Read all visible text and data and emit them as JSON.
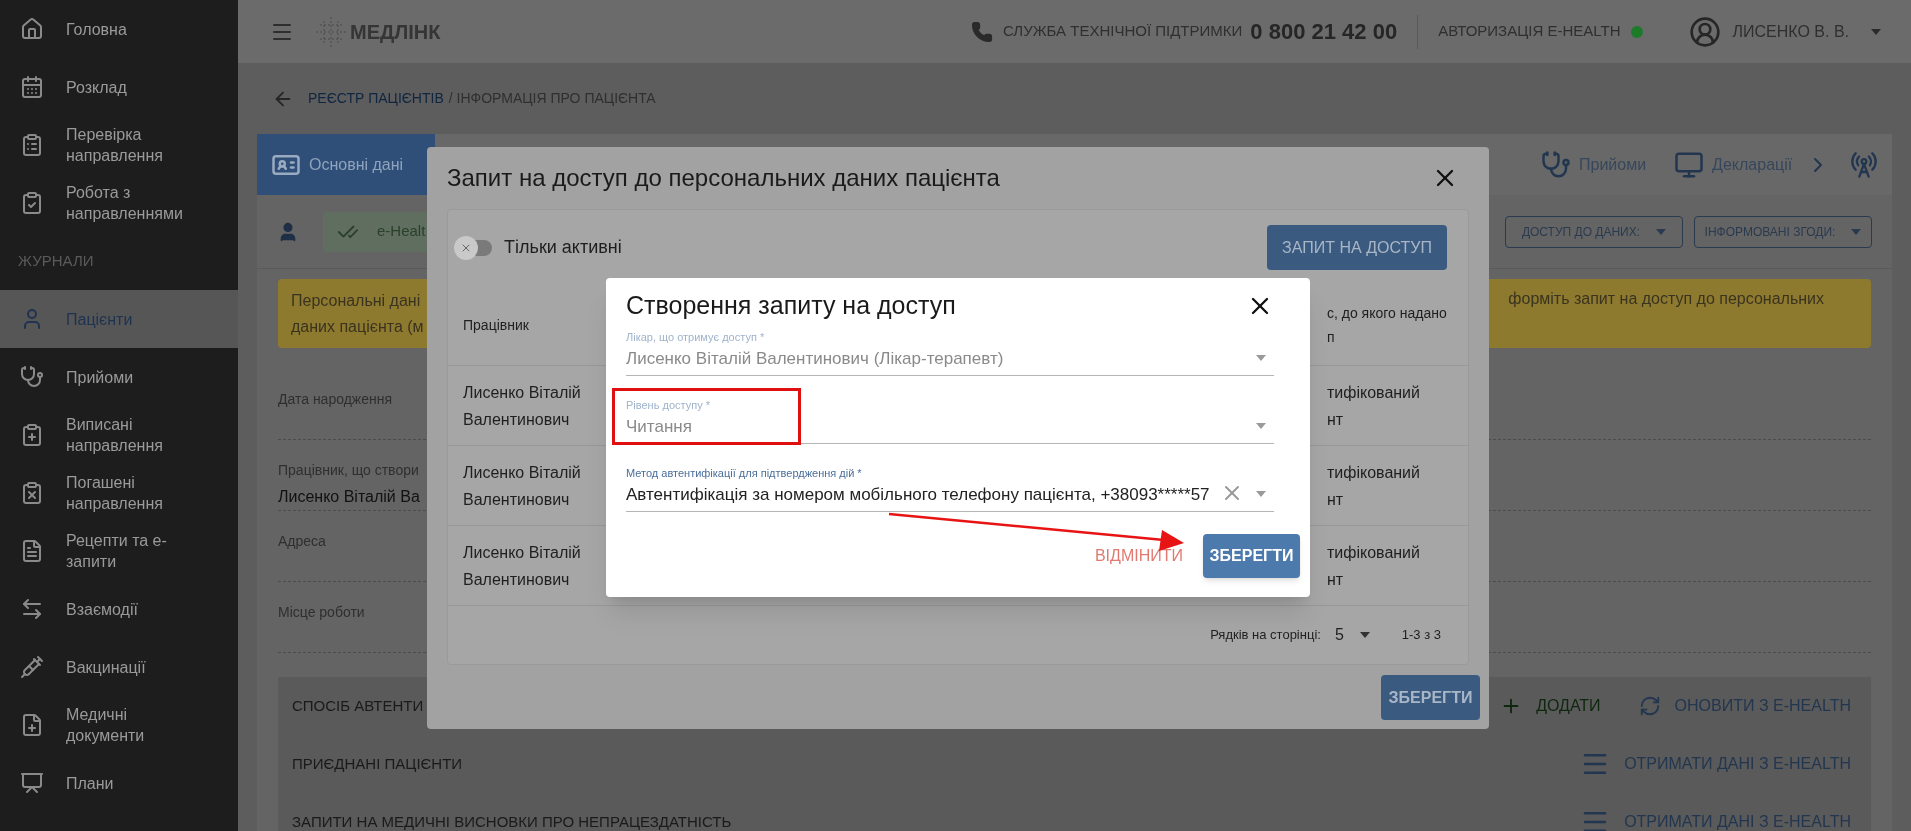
{
  "sidebar": {
    "items": [
      {
        "kind": "link",
        "label": "Головна",
        "selected": false
      },
      {
        "kind": "link",
        "label": "Розклад",
        "selected": false
      },
      {
        "kind": "link",
        "label": "Перевірка направлення",
        "selected": false
      },
      {
        "kind": "link",
        "label": "Робота з направленнями",
        "selected": false
      },
      {
        "kind": "header",
        "label": "ЖУРНАЛИ"
      },
      {
        "kind": "link",
        "label": "Пацієнти",
        "selected": true
      },
      {
        "kind": "link",
        "label": "Прийоми",
        "selected": false
      },
      {
        "kind": "link",
        "label": "Виписані направлення",
        "selected": false
      },
      {
        "kind": "link",
        "label": "Погашені направлення",
        "selected": false
      },
      {
        "kind": "link",
        "label": "Рецепти та е-запити",
        "selected": false
      },
      {
        "kind": "link",
        "label": "Взаємодії",
        "selected": false
      },
      {
        "kind": "link",
        "label": "Вакцинації",
        "selected": false
      },
      {
        "kind": "link",
        "label": "Медичні документи",
        "selected": false
      },
      {
        "kind": "link",
        "label": "Плани",
        "selected": false
      }
    ]
  },
  "topbar": {
    "brand": "МЕДЛІНК",
    "support_label": "СЛУЖБА ТЕХНІЧНОЇ ПІДТРИМКИ",
    "support_phone": "0 800 21 42 00",
    "ehealth_label": "АВТОРИЗАЦІЯ E-HEALTH",
    "ehealth_connected": true,
    "user": "ЛИСЕНКО В. В."
  },
  "breadcrumb": {
    "link": "РЕЄСТР ПАЦІЄНТІВ",
    "current": "/ ІНФОРМАЦІЯ ПРО ПАЦІЄНТА"
  },
  "patient_tabs": [
    {
      "label": "Основні дані",
      "selected": true
    },
    {
      "label": "Прийоми",
      "selected": false
    },
    {
      "label": "Декларації",
      "selected": false
    }
  ],
  "status_chip": "e-Healt",
  "filters": [
    "ДОСТУП ДО ДАНИХ:",
    "ІНФОРМОВАНІ ЗГОДИ:"
  ],
  "banner": {
    "left_lines": [
      "Персональні дані",
      "даних пацієнта (м"
    ],
    "right": "форміть запит на доступ до персональних"
  },
  "fields": [
    {
      "label": "Дата народження"
    },
    {
      "label": "Працівник, що створи",
      "value": "Лисенко Віталій Ва"
    },
    {
      "label": "Адреса"
    },
    {
      "label": "Місце роботи"
    }
  ],
  "sections": [
    {
      "title": "СПОСІБ АВТЕНТИ",
      "actions": [
        {
          "kind": "add",
          "label": "ДОДАТИ"
        },
        {
          "kind": "refresh",
          "label": "ОНОВИТИ З E-HEALTH"
        }
      ]
    },
    {
      "title": "ПРИЄДНАНІ ПАЦІЄНТИ",
      "actions": [
        {
          "kind": "fetch",
          "label": "ОТРИМАТИ ДАНІ З E-HEALTH"
        }
      ]
    },
    {
      "title": "ЗАПИТИ НА МЕДИЧНІ ВИСНОВКИ ПРО НЕПРАЦЕЗДАТНІСТЬ",
      "actions": [
        {
          "kind": "fetch",
          "label": "ОТРИМАТИ ДАНІ З E-HEALTH"
        }
      ]
    }
  ],
  "access_dialog": {
    "title": "Запит на доступ до персональних даних пацієнта",
    "toggle": {
      "label": "Тільки активні",
      "on": false
    },
    "request_button": "ЗАПИТ НА ДОСТУП",
    "columns": [
      "Працівник",
      [
        "с, до якого надано",
        "п"
      ]
    ],
    "rows": [
      {
        "employee": [
          "Лисенко Віталій",
          "Валентинович"
        ],
        "column_2": [
          "тифікований",
          "нт"
        ]
      },
      {
        "employee": [
          "Лисенко Віталій",
          "Валентинович"
        ],
        "column_2": [
          "тифікований",
          "нт"
        ]
      },
      {
        "employee": [
          "Лисенко Віталій",
          "Валентинович"
        ],
        "column_2": [
          "тифікований",
          "нт"
        ]
      }
    ],
    "rows_per_page_label": "Рядків на сторінці:",
    "rows_per_page": "5",
    "range": "1-3 з 3",
    "save_button": "ЗБЕРЕГТИ"
  },
  "create_dialog": {
    "title": "Створення запиту на доступ",
    "fields": [
      {
        "label": "Лікар, що отримує доступ *",
        "value": "Лисенко Віталій Валентинович (Лікар-терапевт)",
        "disabled": true,
        "clearable": false
      },
      {
        "label": "Рівень доступу *",
        "value": "Читання",
        "disabled": true,
        "clearable": false
      },
      {
        "label": "Метод автентифікації для підтвердження дій *",
        "value": "Автентифікація за номером мобільного телефону пацієнта, +38093*****57",
        "disabled": false,
        "clearable": true
      }
    ],
    "cancel_button": "ВІДМІНИТИ",
    "save_button": "ЗБЕРЕГТИ"
  }
}
